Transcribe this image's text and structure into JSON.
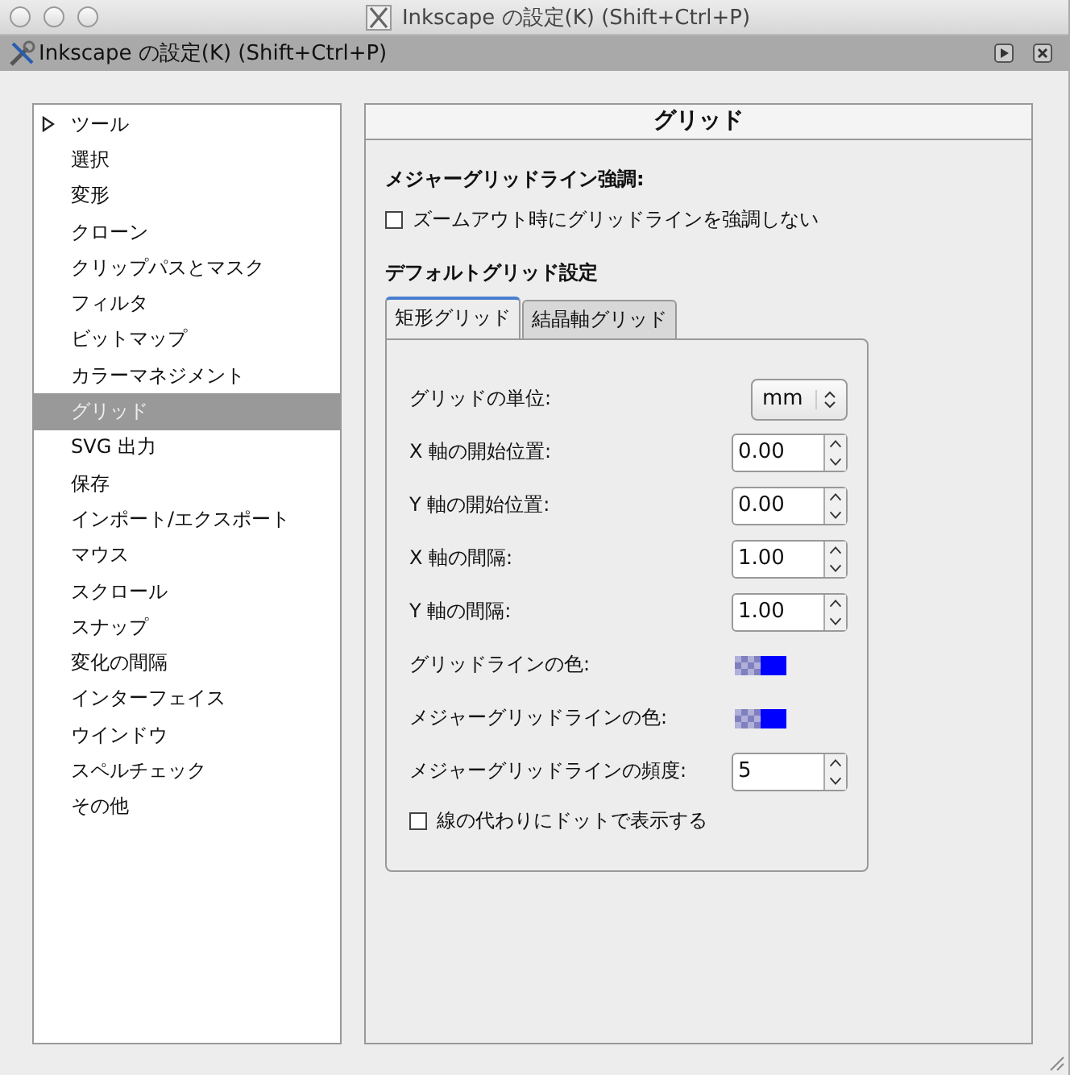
{
  "window": {
    "title": "Inkscape の設定(K) (Shift+Ctrl+P)"
  },
  "dialog": {
    "title": "Inkscape の設定(K) (Shift+Ctrl+P)"
  },
  "sidebar": {
    "items": [
      {
        "label": "ツール",
        "selected": false,
        "expanded": false
      },
      {
        "label": "選択",
        "selected": false
      },
      {
        "label": "変形",
        "selected": false
      },
      {
        "label": "クローン",
        "selected": false
      },
      {
        "label": "クリップパスとマスク",
        "selected": false
      },
      {
        "label": "フィルタ",
        "selected": false
      },
      {
        "label": "ビットマップ",
        "selected": false
      },
      {
        "label": "カラーマネジメント",
        "selected": false
      },
      {
        "label": "グリッド",
        "selected": true
      },
      {
        "label": "SVG 出力",
        "selected": false
      },
      {
        "label": "保存",
        "selected": false
      },
      {
        "label": "インポート/エクスポート",
        "selected": false
      },
      {
        "label": "マウス",
        "selected": false
      },
      {
        "label": "スクロール",
        "selected": false
      },
      {
        "label": "スナップ",
        "selected": false
      },
      {
        "label": "変化の間隔",
        "selected": false
      },
      {
        "label": "インターフェイス",
        "selected": false
      },
      {
        "label": "ウインドウ",
        "selected": false
      },
      {
        "label": "スペルチェック",
        "selected": false
      },
      {
        "label": "その他",
        "selected": false
      }
    ]
  },
  "panel": {
    "title": "グリッド",
    "major_section": {
      "heading": "メジャーグリッドライン強調:",
      "checkbox": {
        "label": "ズームアウト時にグリッドラインを強調しない",
        "checked": false
      }
    },
    "default_section": {
      "heading": "デフォルトグリッド設定",
      "tabs": [
        {
          "label": "矩形グリッド",
          "selected": true
        },
        {
          "label": "結晶軸グリッド",
          "selected": false
        }
      ],
      "rows": [
        {
          "kind": "select",
          "label": "グリッドの単位:",
          "value": "mm"
        },
        {
          "kind": "spin",
          "label": "X 軸の開始位置:",
          "value": "0.00"
        },
        {
          "kind": "spin",
          "label": "Y 軸の開始位置:",
          "value": "0.00"
        },
        {
          "kind": "spin",
          "label": "X 軸の間隔:",
          "value": "1.00"
        },
        {
          "kind": "spin",
          "label": "Y 軸の間隔:",
          "value": "1.00"
        },
        {
          "kind": "color",
          "label": "グリッドラインの色:",
          "color": "#0000ff"
        },
        {
          "kind": "color",
          "label": "メジャーグリッドラインの色:",
          "color": "#0000ff"
        },
        {
          "kind": "spin",
          "label": "メジャーグリッドラインの頻度:",
          "value": "5"
        },
        {
          "kind": "checkbox",
          "label": "線の代わりにドットで表示する",
          "checked": false
        }
      ]
    }
  }
}
